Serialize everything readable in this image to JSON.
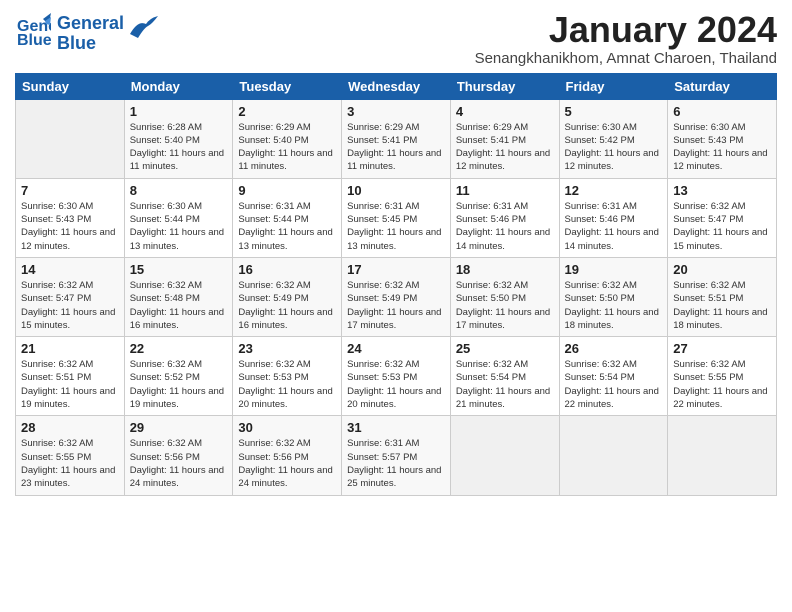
{
  "logo": {
    "line1": "General",
    "line2": "Blue"
  },
  "title": "January 2024",
  "location": "Senangkhanikhom, Amnat Charoen, Thailand",
  "days_of_week": [
    "Sunday",
    "Monday",
    "Tuesday",
    "Wednesday",
    "Thursday",
    "Friday",
    "Saturday"
  ],
  "weeks": [
    [
      {
        "num": "",
        "sunrise": "",
        "sunset": "",
        "daylight": ""
      },
      {
        "num": "1",
        "sunrise": "Sunrise: 6:28 AM",
        "sunset": "Sunset: 5:40 PM",
        "daylight": "Daylight: 11 hours and 11 minutes."
      },
      {
        "num": "2",
        "sunrise": "Sunrise: 6:29 AM",
        "sunset": "Sunset: 5:40 PM",
        "daylight": "Daylight: 11 hours and 11 minutes."
      },
      {
        "num": "3",
        "sunrise": "Sunrise: 6:29 AM",
        "sunset": "Sunset: 5:41 PM",
        "daylight": "Daylight: 11 hours and 11 minutes."
      },
      {
        "num": "4",
        "sunrise": "Sunrise: 6:29 AM",
        "sunset": "Sunset: 5:41 PM",
        "daylight": "Daylight: 11 hours and 12 minutes."
      },
      {
        "num": "5",
        "sunrise": "Sunrise: 6:30 AM",
        "sunset": "Sunset: 5:42 PM",
        "daylight": "Daylight: 11 hours and 12 minutes."
      },
      {
        "num": "6",
        "sunrise": "Sunrise: 6:30 AM",
        "sunset": "Sunset: 5:43 PM",
        "daylight": "Daylight: 11 hours and 12 minutes."
      }
    ],
    [
      {
        "num": "7",
        "sunrise": "Sunrise: 6:30 AM",
        "sunset": "Sunset: 5:43 PM",
        "daylight": "Daylight: 11 hours and 12 minutes."
      },
      {
        "num": "8",
        "sunrise": "Sunrise: 6:30 AM",
        "sunset": "Sunset: 5:44 PM",
        "daylight": "Daylight: 11 hours and 13 minutes."
      },
      {
        "num": "9",
        "sunrise": "Sunrise: 6:31 AM",
        "sunset": "Sunset: 5:44 PM",
        "daylight": "Daylight: 11 hours and 13 minutes."
      },
      {
        "num": "10",
        "sunrise": "Sunrise: 6:31 AM",
        "sunset": "Sunset: 5:45 PM",
        "daylight": "Daylight: 11 hours and 13 minutes."
      },
      {
        "num": "11",
        "sunrise": "Sunrise: 6:31 AM",
        "sunset": "Sunset: 5:46 PM",
        "daylight": "Daylight: 11 hours and 14 minutes."
      },
      {
        "num": "12",
        "sunrise": "Sunrise: 6:31 AM",
        "sunset": "Sunset: 5:46 PM",
        "daylight": "Daylight: 11 hours and 14 minutes."
      },
      {
        "num": "13",
        "sunrise": "Sunrise: 6:32 AM",
        "sunset": "Sunset: 5:47 PM",
        "daylight": "Daylight: 11 hours and 15 minutes."
      }
    ],
    [
      {
        "num": "14",
        "sunrise": "Sunrise: 6:32 AM",
        "sunset": "Sunset: 5:47 PM",
        "daylight": "Daylight: 11 hours and 15 minutes."
      },
      {
        "num": "15",
        "sunrise": "Sunrise: 6:32 AM",
        "sunset": "Sunset: 5:48 PM",
        "daylight": "Daylight: 11 hours and 16 minutes."
      },
      {
        "num": "16",
        "sunrise": "Sunrise: 6:32 AM",
        "sunset": "Sunset: 5:49 PM",
        "daylight": "Daylight: 11 hours and 16 minutes."
      },
      {
        "num": "17",
        "sunrise": "Sunrise: 6:32 AM",
        "sunset": "Sunset: 5:49 PM",
        "daylight": "Daylight: 11 hours and 17 minutes."
      },
      {
        "num": "18",
        "sunrise": "Sunrise: 6:32 AM",
        "sunset": "Sunset: 5:50 PM",
        "daylight": "Daylight: 11 hours and 17 minutes."
      },
      {
        "num": "19",
        "sunrise": "Sunrise: 6:32 AM",
        "sunset": "Sunset: 5:50 PM",
        "daylight": "Daylight: 11 hours and 18 minutes."
      },
      {
        "num": "20",
        "sunrise": "Sunrise: 6:32 AM",
        "sunset": "Sunset: 5:51 PM",
        "daylight": "Daylight: 11 hours and 18 minutes."
      }
    ],
    [
      {
        "num": "21",
        "sunrise": "Sunrise: 6:32 AM",
        "sunset": "Sunset: 5:51 PM",
        "daylight": "Daylight: 11 hours and 19 minutes."
      },
      {
        "num": "22",
        "sunrise": "Sunrise: 6:32 AM",
        "sunset": "Sunset: 5:52 PM",
        "daylight": "Daylight: 11 hours and 19 minutes."
      },
      {
        "num": "23",
        "sunrise": "Sunrise: 6:32 AM",
        "sunset": "Sunset: 5:53 PM",
        "daylight": "Daylight: 11 hours and 20 minutes."
      },
      {
        "num": "24",
        "sunrise": "Sunrise: 6:32 AM",
        "sunset": "Sunset: 5:53 PM",
        "daylight": "Daylight: 11 hours and 20 minutes."
      },
      {
        "num": "25",
        "sunrise": "Sunrise: 6:32 AM",
        "sunset": "Sunset: 5:54 PM",
        "daylight": "Daylight: 11 hours and 21 minutes."
      },
      {
        "num": "26",
        "sunrise": "Sunrise: 6:32 AM",
        "sunset": "Sunset: 5:54 PM",
        "daylight": "Daylight: 11 hours and 22 minutes."
      },
      {
        "num": "27",
        "sunrise": "Sunrise: 6:32 AM",
        "sunset": "Sunset: 5:55 PM",
        "daylight": "Daylight: 11 hours and 22 minutes."
      }
    ],
    [
      {
        "num": "28",
        "sunrise": "Sunrise: 6:32 AM",
        "sunset": "Sunset: 5:55 PM",
        "daylight": "Daylight: 11 hours and 23 minutes."
      },
      {
        "num": "29",
        "sunrise": "Sunrise: 6:32 AM",
        "sunset": "Sunset: 5:56 PM",
        "daylight": "Daylight: 11 hours and 24 minutes."
      },
      {
        "num": "30",
        "sunrise": "Sunrise: 6:32 AM",
        "sunset": "Sunset: 5:56 PM",
        "daylight": "Daylight: 11 hours and 24 minutes."
      },
      {
        "num": "31",
        "sunrise": "Sunrise: 6:31 AM",
        "sunset": "Sunset: 5:57 PM",
        "daylight": "Daylight: 11 hours and 25 minutes."
      },
      {
        "num": "",
        "sunrise": "",
        "sunset": "",
        "daylight": ""
      },
      {
        "num": "",
        "sunrise": "",
        "sunset": "",
        "daylight": ""
      },
      {
        "num": "",
        "sunrise": "",
        "sunset": "",
        "daylight": ""
      }
    ]
  ]
}
